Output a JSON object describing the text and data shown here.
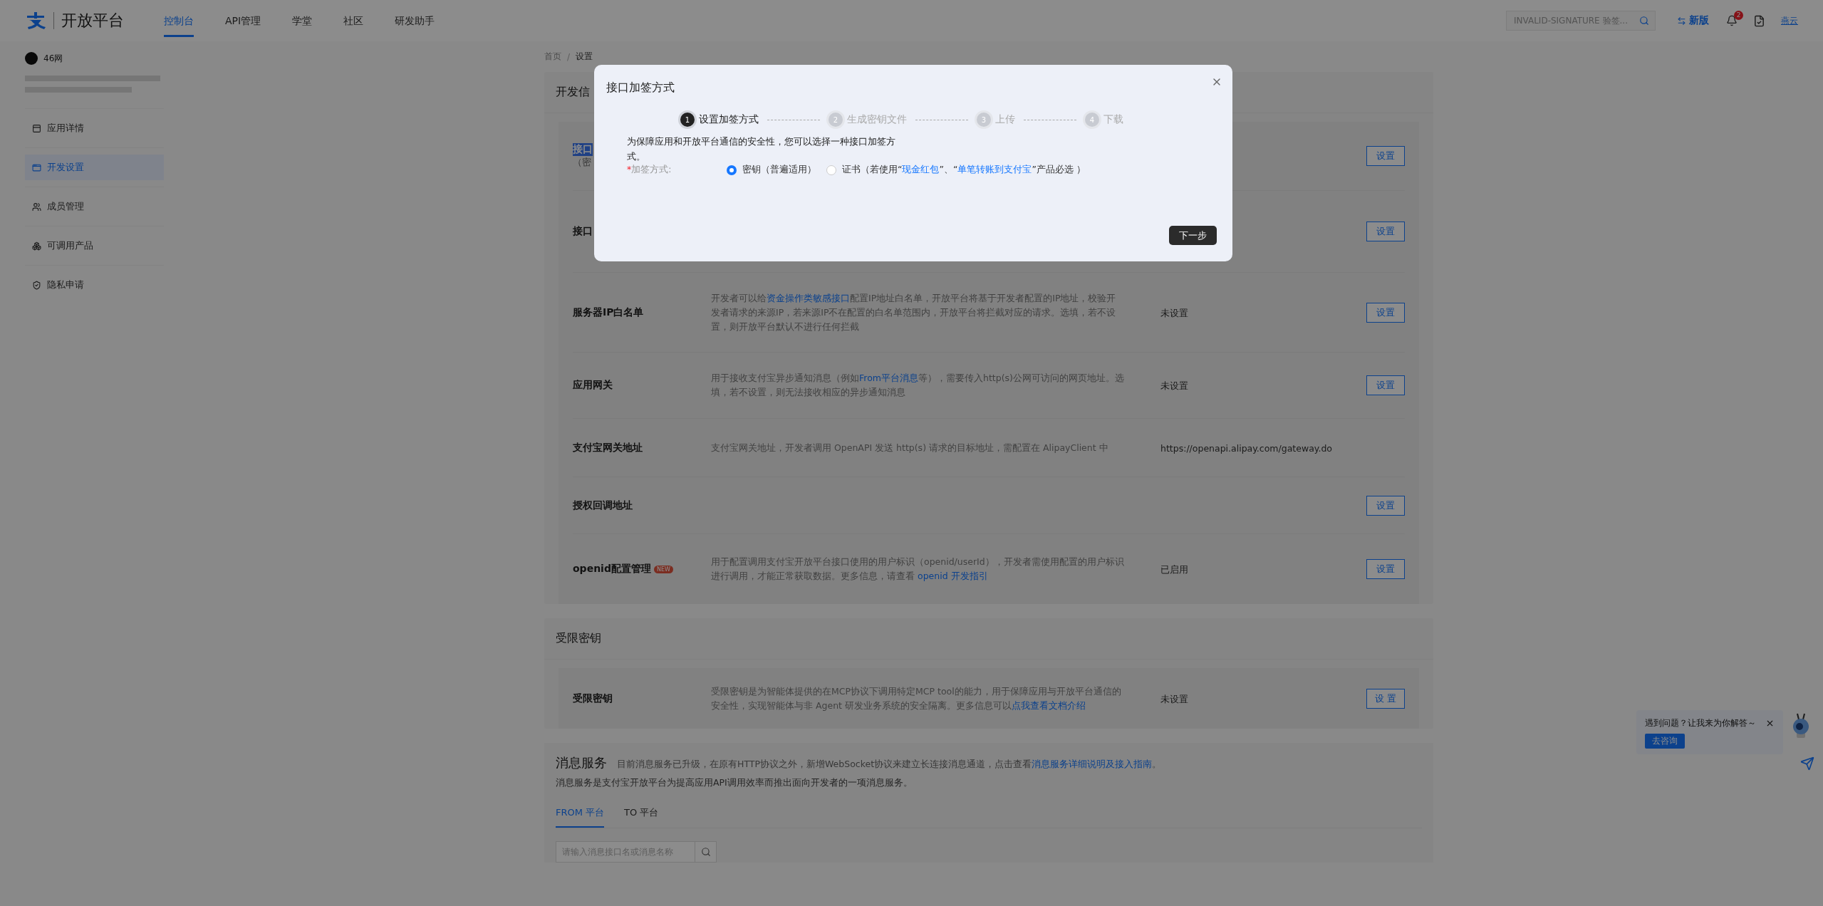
{
  "top_nav": {
    "logo_text": "开放平台",
    "tabs": [
      {
        "label": "控制台",
        "selected": true
      },
      {
        "label": "API管理",
        "selected": false
      },
      {
        "label": "学堂",
        "selected": false
      },
      {
        "label": "社区",
        "selected": false
      },
      {
        "label": "研发助手",
        "selected": false
      }
    ],
    "search": {
      "placeholder": "INVALID-SIGNATURE 验签..."
    },
    "new_version": "新版",
    "notification_count": "2",
    "user": "燕云"
  },
  "sidebar": {
    "app_name": "46网",
    "items": [
      {
        "label": "应用详情",
        "selected": false
      },
      {
        "label": "开发设置",
        "selected": true
      },
      {
        "label": "成员管理",
        "selected": false
      },
      {
        "label": "可调用产品",
        "selected": false
      },
      {
        "label": "隐私申请",
        "selected": false
      }
    ]
  },
  "breadcrumb": [
    "首页",
    "设置"
  ],
  "breadcrumb_separator": "/",
  "dev_section": {
    "title": "开发信",
    "rows": [
      {
        "label": "接口",
        "note": "（密",
        "highlighted": true,
        "button": "设置"
      },
      {
        "label": "接口",
        "highlighted": false,
        "button": "设置"
      },
      {
        "label": "服务器IP白名单",
        "highlighted": false,
        "description": [
          {
            "text": "开发者可以给",
            "link": false
          },
          {
            "text": "资金操作类敏感接口",
            "link": true
          },
          {
            "text": "配置IP地址白名单，开放平台将基于开发者配置的IP地址，校验开发者请求的来源IP，若来源IP不在配置的白名单范围内，开放平台将拦截对应的请求。选填，若不设置，则开放平台默认不进行任何拦截",
            "link": false
          }
        ],
        "value": "未设置",
        "button": "设置"
      },
      {
        "label": "应用网关",
        "highlighted": false,
        "description": [
          {
            "text": "用于接收支付宝异步通知消息（例如",
            "link": false
          },
          {
            "text": "From平台消息",
            "link": true
          },
          {
            "text": "等），需要传入http(s)公网可访问的网页地址。选填，若不设置，则无法接收相应的异步通知消息",
            "link": false
          }
        ],
        "value": "未设置",
        "button": "设置"
      },
      {
        "label": "支付宝网关地址",
        "highlighted": false,
        "description": [
          {
            "text": "支付宝网关地址，开发者调用 OpenAPI 发送 http(s) 请求的目标地址，需配置在 AlipayClient 中",
            "link": false
          }
        ],
        "value": "https://openapi.alipay.com/gateway.do"
      },
      {
        "label": "授权回调地址",
        "highlighted": false,
        "button": "设置"
      },
      {
        "label": "openid配置管理",
        "badge": "NEW",
        "highlighted": false,
        "description": [
          {
            "text": "用于配置调用支付宝开放平台接口使用的用户标识（openid/userId），开发者需使用配置的用户标识进行调用，才能正常获取数据。更多信息，请查看 ",
            "link": false
          },
          {
            "text": "openid 开发指引",
            "link": true
          }
        ],
        "value": "已启用",
        "button": "设置"
      }
    ]
  },
  "restricted_section": {
    "title": "受限密钥",
    "rows": [
      {
        "label": "受限密钥",
        "highlighted": false,
        "description": [
          {
            "text": "受限密钥是为智能体提供的在MCP协议下调用特定MCP tool的能力，用于保障应用与开放平台通信的安全性，实现智能体与非 Agent 研发业务系统的安全隔离。更多信息可以",
            "link": false
          },
          {
            "text": "点我查看文档介绍",
            "link": true
          }
        ],
        "value": "未设置",
        "button": "设 置"
      }
    ]
  },
  "message_section": {
    "title": "消息服务",
    "notice": [
      {
        "text": "目前消息服务已升级，在原有HTTP协议之外，新增WebSocket协议来建立长连接消息通道，点击查看",
        "link": false
      },
      {
        "text": "消息服务详细说明及接入指南",
        "link": true
      },
      {
        "text": "。",
        "link": false
      }
    ],
    "subtitle": "消息服务是支付宝开放平台为提高应用API调用效率而推出面向开发者的一项消息服务。",
    "tabs": [
      {
        "label": "FROM 平台",
        "selected": true
      },
      {
        "label": "TO 平台",
        "selected": false
      }
    ],
    "search": {
      "placeholder": "请输入消息接口名或消息名称"
    }
  },
  "help_widget": {
    "message": "遇到问题？让我来为你解答～",
    "button": "去咨询"
  },
  "modal": {
    "title": "接口加签方式",
    "steps": [
      {
        "number": "1",
        "label": "设置加签方式",
        "active": true
      },
      {
        "number": "2",
        "label": "生成密钥文件",
        "active": false
      },
      {
        "number": "3",
        "label": "上传",
        "active": false
      },
      {
        "number": "4",
        "label": "下载",
        "active": false
      }
    ],
    "description": "为保障应用和开放平台通信的安全性，您可以选择一种接口加签方式。",
    "field": {
      "required_mark": "*",
      "label": "加签方式:",
      "options": [
        {
          "selected": true,
          "segments": [
            {
              "text": "密钥（普遍适用）",
              "link": false
            }
          ]
        },
        {
          "selected": false,
          "segments": [
            {
              "text": "证书（若使用“",
              "link": false
            },
            {
              "text": "现金红包",
              "link": true
            },
            {
              "text": "”、“",
              "link": false
            },
            {
              "text": "单笔转账到支付宝",
              "link": true
            },
            {
              "text": "”产品必选 ）",
              "link": false
            }
          ]
        }
      ]
    },
    "next_button": "下一步"
  }
}
